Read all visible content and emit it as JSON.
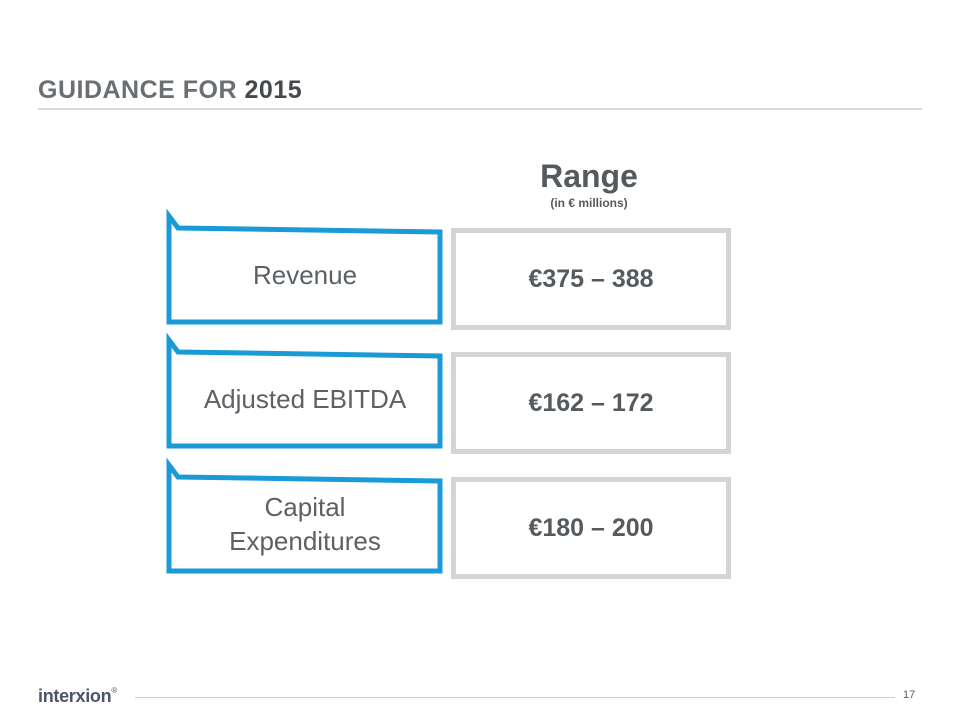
{
  "slide": {
    "title_prefix": "GUIDANCE FOR ",
    "title_year": "2015"
  },
  "range_heading": {
    "title": "Range",
    "subtitle": "(in € millions)"
  },
  "guidance": {
    "rows": [
      {
        "label": "Revenue",
        "value": "€375 – 388"
      },
      {
        "label": "Adjusted EBITDA",
        "value": "€162 – 172"
      },
      {
        "label": "Capital\nExpenditures",
        "value": "€180 – 200"
      }
    ]
  },
  "footer": {
    "logo": "interxion",
    "logo_mark": "®",
    "page_number": "17"
  },
  "colors": {
    "accent_blue": "#1a9ad6",
    "value_border": "#d4d4d4",
    "text_gray": "#5c6166"
  }
}
